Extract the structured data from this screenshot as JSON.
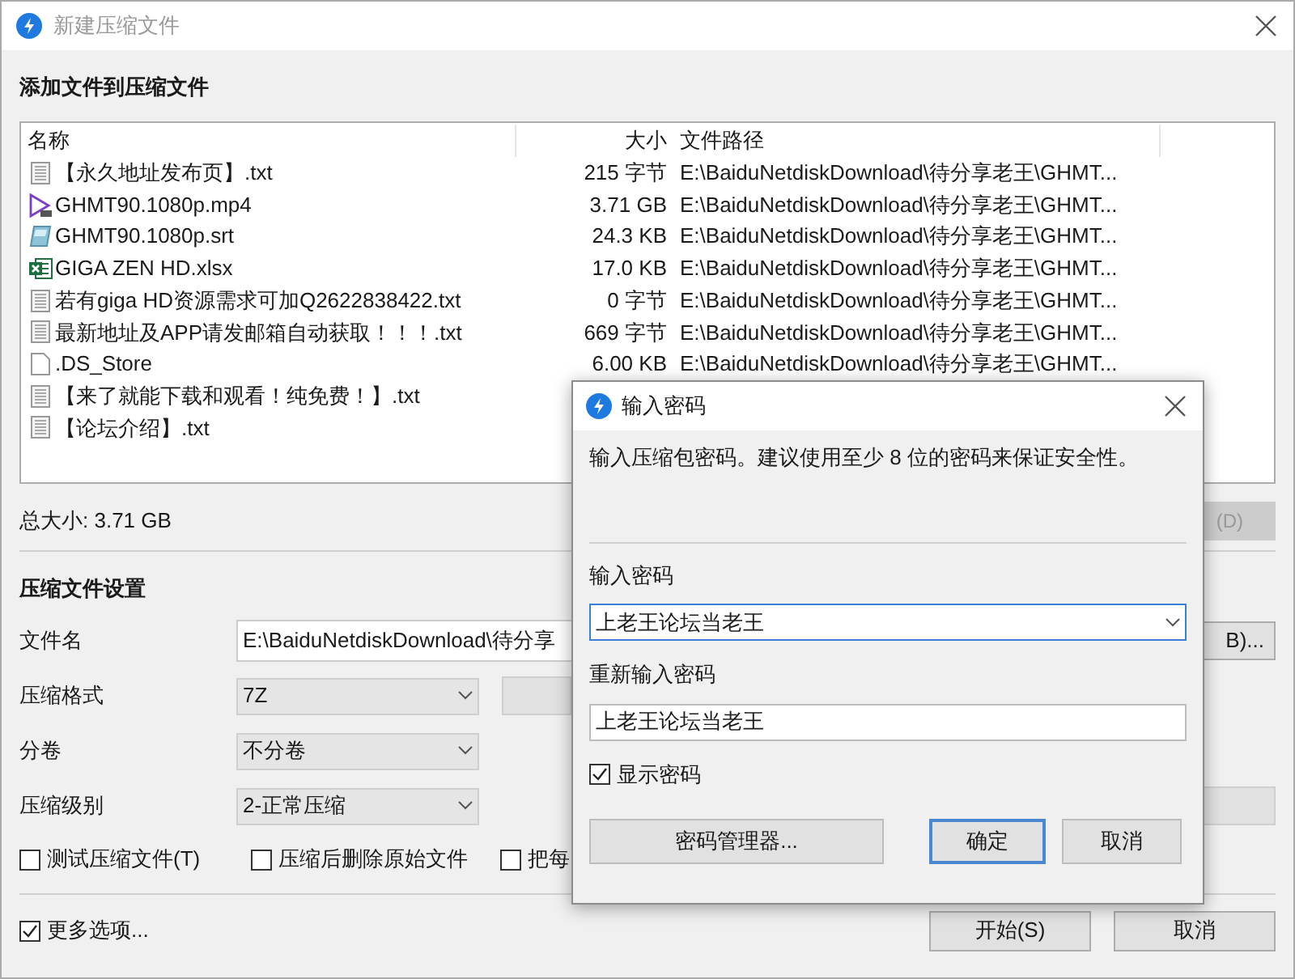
{
  "window": {
    "title": "新建压缩文件"
  },
  "heading": "添加文件到压缩文件",
  "file_list": {
    "columns": [
      "名称",
      "大小",
      "文件路径"
    ],
    "rows": [
      {
        "kind": "text",
        "name": "【永久地址发布页】.txt",
        "size": "215 字节",
        "path": "E:\\BaiduNetdiskDownload\\待分享老王\\GHMT..."
      },
      {
        "kind": "video",
        "name": "GHMT90.1080p.mp4",
        "size": "3.71 GB",
        "path": "E:\\BaiduNetdiskDownload\\待分享老王\\GHMT..."
      },
      {
        "kind": "subtitle",
        "name": "GHMT90.1080p.srt",
        "size": "24.3 KB",
        "path": "E:\\BaiduNetdiskDownload\\待分享老王\\GHMT..."
      },
      {
        "kind": "sheet",
        "name": "GIGA ZEN HD.xlsx",
        "size": "17.0 KB",
        "path": "E:\\BaiduNetdiskDownload\\待分享老王\\GHMT..."
      },
      {
        "kind": "text",
        "name": "若有giga HD资源需求可加Q2622838422.txt",
        "size": "0 字节",
        "path": "E:\\BaiduNetdiskDownload\\待分享老王\\GHMT..."
      },
      {
        "kind": "text",
        "name": "最新地址及APP请发邮箱自动获取！！！.txt",
        "size": "669 字节",
        "path": "E:\\BaiduNetdiskDownload\\待分享老王\\GHMT..."
      },
      {
        "kind": "blank",
        "name": ".DS_Store",
        "size": "6.00 KB",
        "path": "E:\\BaiduNetdiskDownload\\待分享老王\\GHMT..."
      },
      {
        "kind": "text",
        "name": "【来了就能下载和观看！纯免费！】.txt"
      },
      {
        "kind": "text",
        "name": "【论坛介绍】.txt"
      }
    ]
  },
  "total_size": "总大小: 3.71 GB",
  "list_button": "(D)",
  "settings": {
    "heading": "压缩文件设置",
    "filename": {
      "label": "文件名",
      "value": "E:\\BaiduNetdiskDownload\\待分享",
      "button": "B)..."
    },
    "selects": [
      {
        "label": "压缩格式",
        "value": "7Z"
      },
      {
        "label": "分卷",
        "value": "不分卷"
      },
      {
        "label": "压缩级别",
        "value": "2-正常压缩"
      }
    ],
    "options": [
      {
        "label": "测试压缩文件(T)",
        "checked": false
      },
      {
        "label": "压缩后删除原始文件",
        "checked": false
      },
      {
        "label": "把每",
        "checked": false
      }
    ],
    "more_options": {
      "label": "更多选项...",
      "checked": true
    }
  },
  "buttons": [
    "开始(S)",
    "取消"
  ],
  "password_dialog": {
    "title": "输入密码",
    "description": "输入压缩包密码。建议使用至少 8 位的密码来保证安全性。",
    "password_label": "输入密码",
    "password": "上老王论坛当老王",
    "confirm_label": "重新输入密码",
    "confirm": "上老王论坛当老王",
    "show_password": {
      "label": "显示密码",
      "checked": true
    },
    "buttons": [
      {
        "label": "密码管理器...",
        "default": false
      },
      {
        "label": "确定",
        "default": true
      },
      {
        "label": "取消",
        "default": false
      }
    ]
  }
}
